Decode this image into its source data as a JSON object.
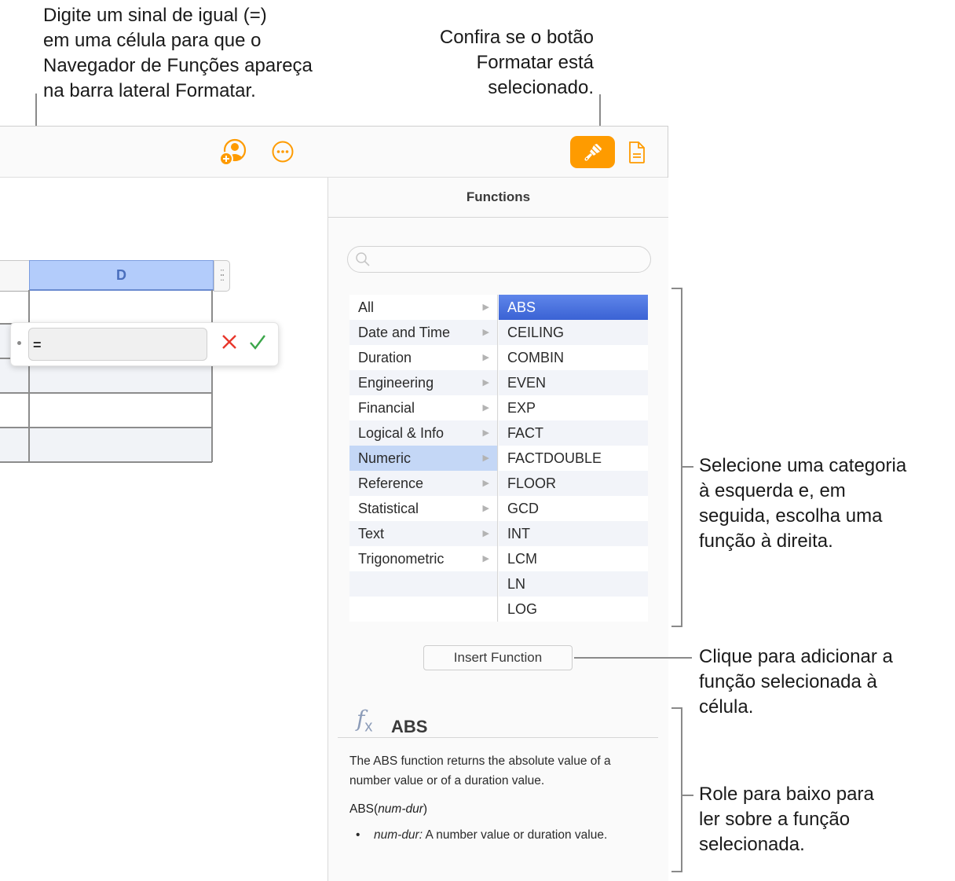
{
  "callouts": {
    "equal_sign": "Digite um sinal de igual (=)\nem uma célula para que o\nNavegador de Funções apareça\nna barra lateral Formatar.",
    "format_button": "Confira se o botão\nFormatar está\nselecionado.",
    "select_category": "Selecione uma categoria\nà esquerda e, em\nseguida, escolha uma\nfunção à direita.",
    "insert_function": "Clique para adicionar a\nfunção selecionada à\ncélula.",
    "scroll_down": "Role para baixo para\nler sobre a função\nselecionada."
  },
  "toolbar": {
    "icons": [
      "collaborate-icon",
      "more-icon",
      "format-paintbrush-icon",
      "document-icon"
    ],
    "accent": "#fe9b00",
    "format_selected": true
  },
  "sheet": {
    "column_header": "D",
    "formula": {
      "value": "=",
      "cancel_icon": "x-icon",
      "confirm_icon": "checkmark-icon"
    }
  },
  "sidebar": {
    "title": "Functions",
    "search": {
      "placeholder": "",
      "value": ""
    },
    "categories": [
      {
        "label": "All",
        "selected": false
      },
      {
        "label": "Date and Time",
        "selected": false
      },
      {
        "label": "Duration",
        "selected": false
      },
      {
        "label": "Engineering",
        "selected": false
      },
      {
        "label": "Financial",
        "selected": false
      },
      {
        "label": "Logical & Info",
        "selected": false
      },
      {
        "label": "Numeric",
        "selected": true
      },
      {
        "label": "Reference",
        "selected": false
      },
      {
        "label": "Statistical",
        "selected": false
      },
      {
        "label": "Text",
        "selected": false
      },
      {
        "label": "Trigonometric",
        "selected": false
      },
      {
        "label": "",
        "selected": false
      },
      {
        "label": "",
        "selected": false
      }
    ],
    "functions": [
      {
        "label": "ABS",
        "selected": true
      },
      {
        "label": "CEILING",
        "selected": false
      },
      {
        "label": "COMBIN",
        "selected": false
      },
      {
        "label": "EVEN",
        "selected": false
      },
      {
        "label": "EXP",
        "selected": false
      },
      {
        "label": "FACT",
        "selected": false
      },
      {
        "label": "FACTDOUBLE",
        "selected": false
      },
      {
        "label": "FLOOR",
        "selected": false
      },
      {
        "label": "GCD",
        "selected": false
      },
      {
        "label": "INT",
        "selected": false
      },
      {
        "label": "LCM",
        "selected": false
      },
      {
        "label": "LN",
        "selected": false
      },
      {
        "label": "LOG",
        "selected": false
      }
    ],
    "insert_button": "Insert Function",
    "detail": {
      "name": "ABS",
      "description": "The ABS function returns the absolute value of a number value or of a duration value.",
      "syntax_name": "ABS",
      "syntax_arg": "num-dur",
      "arg_name": "num-dur:",
      "arg_desc": " A number value or duration value."
    }
  }
}
